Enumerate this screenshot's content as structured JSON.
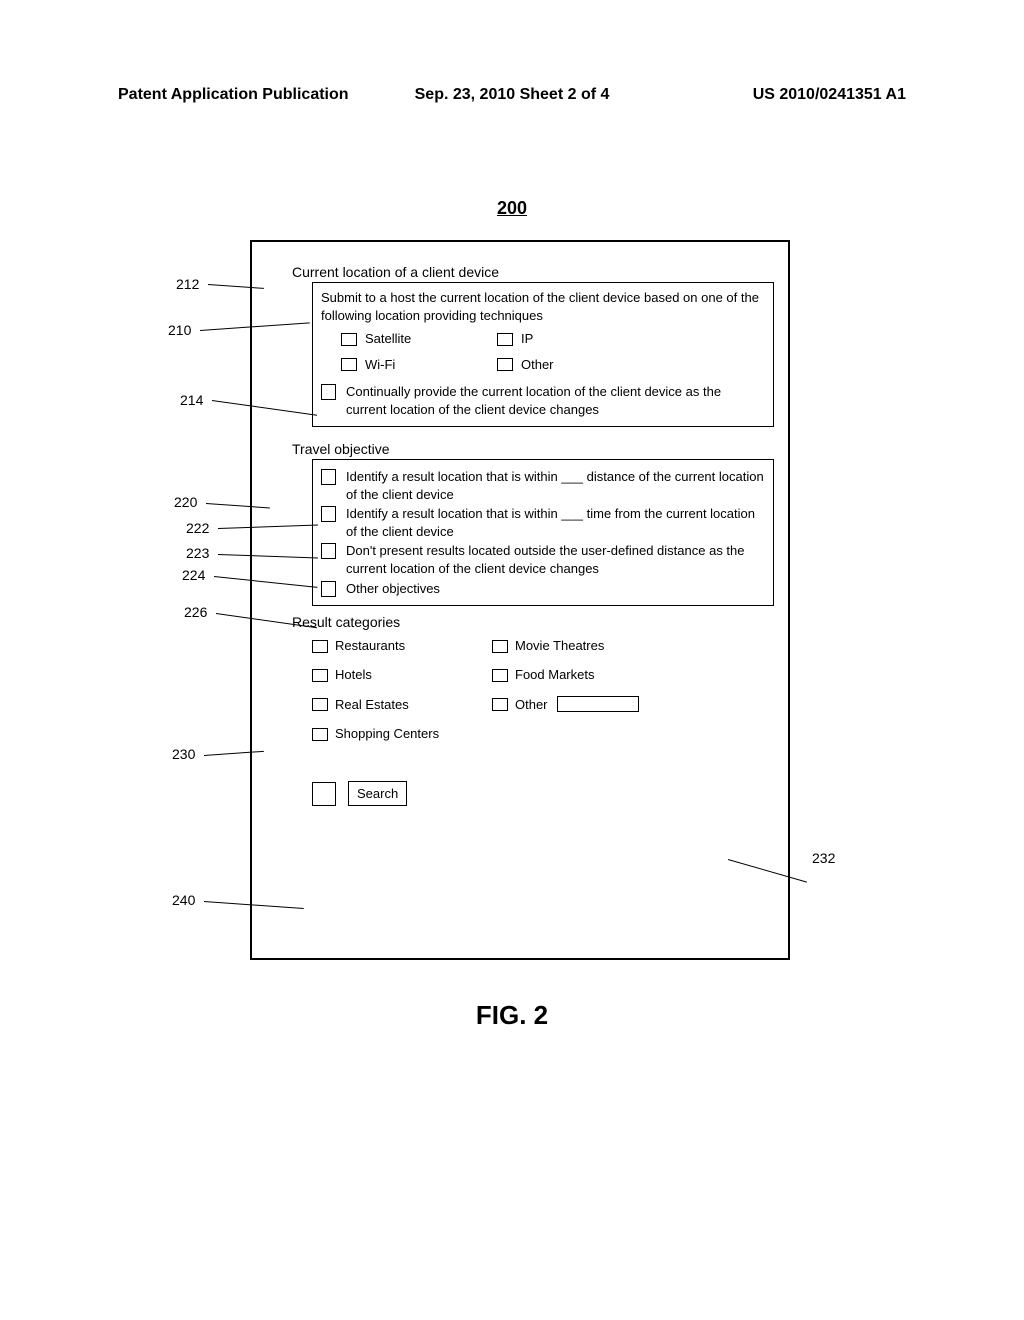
{
  "header": {
    "left": "Patent Application Publication",
    "center": "Sep. 23, 2010  Sheet 2 of 4",
    "right": "US 2010/0241351 A1"
  },
  "fig_ref_top": "200",
  "fig_caption": "FIG. 2",
  "section_location": {
    "title": "Current location of a client device",
    "submit_text": "Submit to a host the current location of the client device based on one of the following location providing techniques",
    "opts": {
      "satellite": "Satellite",
      "ip": "IP",
      "wifi": "Wi-Fi",
      "other": "Other"
    },
    "continual_text": "Continually provide the current location of the client device as the current location of the client device changes"
  },
  "section_objective": {
    "title": "Travel objective",
    "row_distance": "Identify a result location that is within ___ distance of the current location of the client device",
    "row_time": "Identify a result location that is within ___ time from the current location of the client device",
    "row_nooutside": "Don't present results located outside the user-defined distance as the current location of the client device changes",
    "row_other": "Other objectives"
  },
  "section_categories": {
    "title": "Result categories",
    "items": {
      "restaurants": "Restaurants",
      "movies": "Movie Theatres",
      "hotels": "Hotels",
      "food": "Food Markets",
      "realestate": "Real Estates",
      "other": "Other",
      "shopping": "Shopping Centers"
    }
  },
  "search_label": "Search",
  "refs": {
    "r212": "212",
    "r210": "210",
    "r214": "214",
    "r220": "220",
    "r222": "222",
    "r223": "223",
    "r224": "224",
    "r226": "226",
    "r230": "230",
    "r232": "232",
    "r240": "240"
  }
}
